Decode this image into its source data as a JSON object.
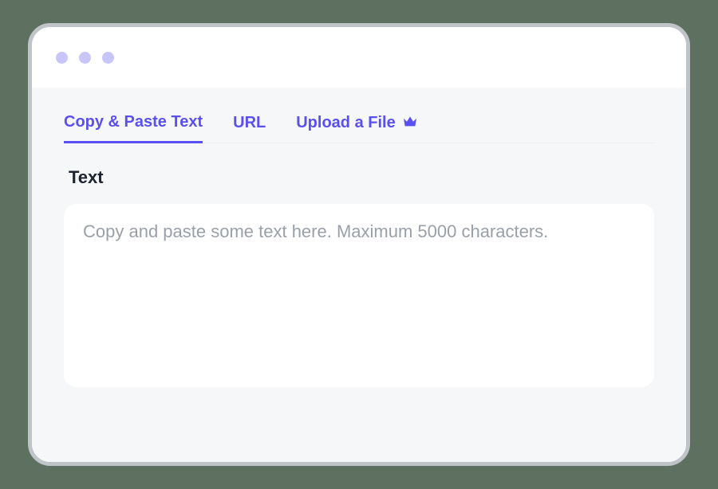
{
  "tabs": [
    {
      "label": "Copy & Paste Text",
      "active": true
    },
    {
      "label": "URL",
      "active": false
    },
    {
      "label": "Upload a File",
      "active": false,
      "hasCrown": true
    }
  ],
  "section": {
    "label": "Text"
  },
  "textarea": {
    "placeholder": "Copy and paste some text here. Maximum 5000 characters."
  },
  "colors": {
    "accent": "#5a4ff0",
    "dot": "#c8c6f9",
    "contentBg": "#f6f7f9"
  }
}
